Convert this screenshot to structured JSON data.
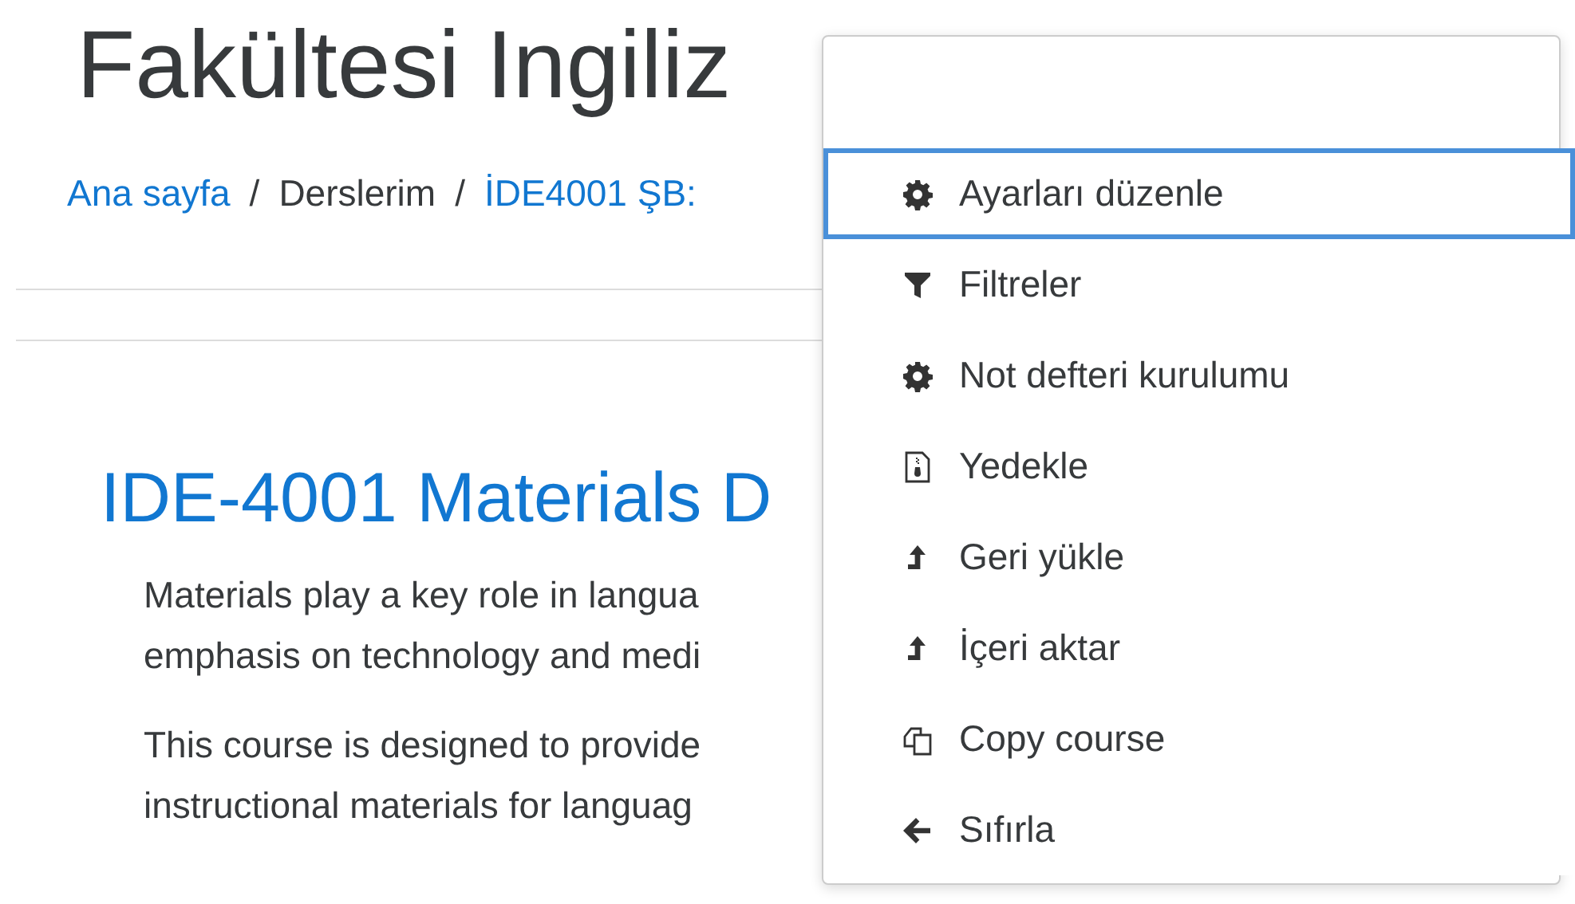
{
  "page_title": "Fakültesi Ingiliz",
  "breadcrumb": [
    {
      "label": "Ana sayfa",
      "link": true
    },
    {
      "label": "/",
      "link": false
    },
    {
      "label": "Derslerim",
      "link": false
    },
    {
      "label": "/",
      "link": false
    },
    {
      "label": "İDE4001 ŞB:",
      "link": true
    }
  ],
  "course": {
    "heading": "IDE-4001 Materials D",
    "paragraphs": [
      [
        "Materials play a key role in langua",
        "emphasis on technology and medi"
      ],
      [
        "This course is designed to provide",
        "instructional materials for languag"
      ]
    ]
  },
  "menu": {
    "items": [
      {
        "kind": "gear",
        "label": "Ayarları düzenle",
        "selected": true
      },
      {
        "kind": "filter",
        "label": "Filtreler",
        "selected": false
      },
      {
        "kind": "gear",
        "label": "Not defteri kurulumu",
        "selected": false
      },
      {
        "kind": "archive",
        "label": "Yedekle",
        "selected": false
      },
      {
        "kind": "upload",
        "label": "Geri yükle",
        "selected": false
      },
      {
        "kind": "upload",
        "label": "İçeri aktar",
        "selected": false
      },
      {
        "kind": "copy",
        "label": "Copy course",
        "selected": false
      },
      {
        "kind": "back",
        "label": "Sıfırla",
        "selected": false
      }
    ]
  }
}
